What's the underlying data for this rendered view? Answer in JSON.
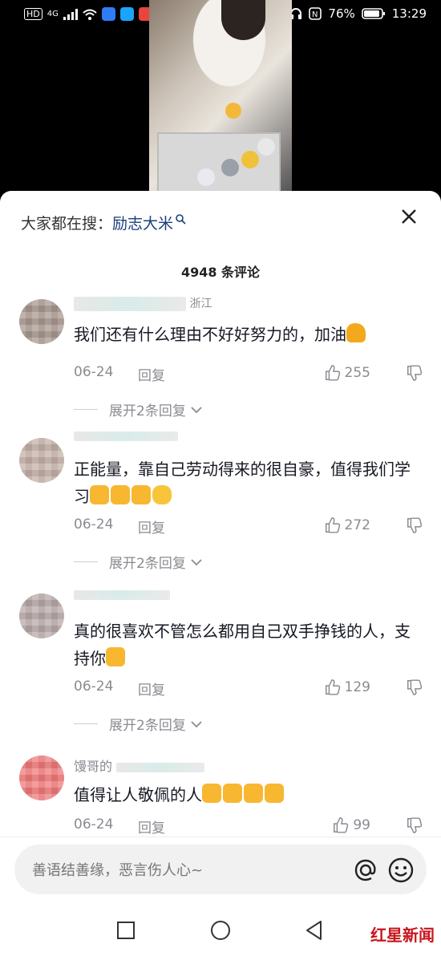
{
  "status_bar": {
    "network": "4G",
    "battery": "76%",
    "time": "13:29"
  },
  "search_suggest": {
    "prefix": "大家都在搜：",
    "keyword": "励志大米"
  },
  "comment_count": "4948 条评论",
  "comments": [
    {
      "username_visible": "浙江",
      "text": "我们还有什么理由不好好努力的，加油",
      "emojis": [
        "flexed-biceps"
      ],
      "date": "06-24",
      "reply_label": "回复",
      "likes": "255",
      "expand_label": "展开2条回复"
    },
    {
      "username_visible": "",
      "text": "正能量，靠自己劳动得来的很自豪，值得我们学习",
      "emojis": [
        "thumbs-up",
        "thumbs-up",
        "thumbs-up",
        "finger-heart"
      ],
      "date": "06-24",
      "reply_label": "回复",
      "likes": "272",
      "expand_label": "展开2条回复"
    },
    {
      "username_visible": "",
      "text": "真的很喜欢不管怎么都用自己双手挣钱的人，支持你",
      "emojis": [
        "thumbs-up"
      ],
      "date": "06-24",
      "reply_label": "回复",
      "likes": "129",
      "expand_label": "展开2条回复"
    },
    {
      "username_visible": "馒哥的",
      "text": "值得让人敬佩的人",
      "emojis": [
        "thumbs-up",
        "thumbs-up",
        "thumbs-up",
        "thumbs-up"
      ],
      "date": "06-24",
      "reply_label": "回复",
      "likes": "99"
    }
  ],
  "input": {
    "placeholder": "善语结善缘，恶言伤人心~"
  },
  "watermark": "红星新闻",
  "colors": {
    "keyword": "#1a3e7a",
    "meta_gray": "#8a8b91",
    "watermark_red": "#c8161d"
  }
}
